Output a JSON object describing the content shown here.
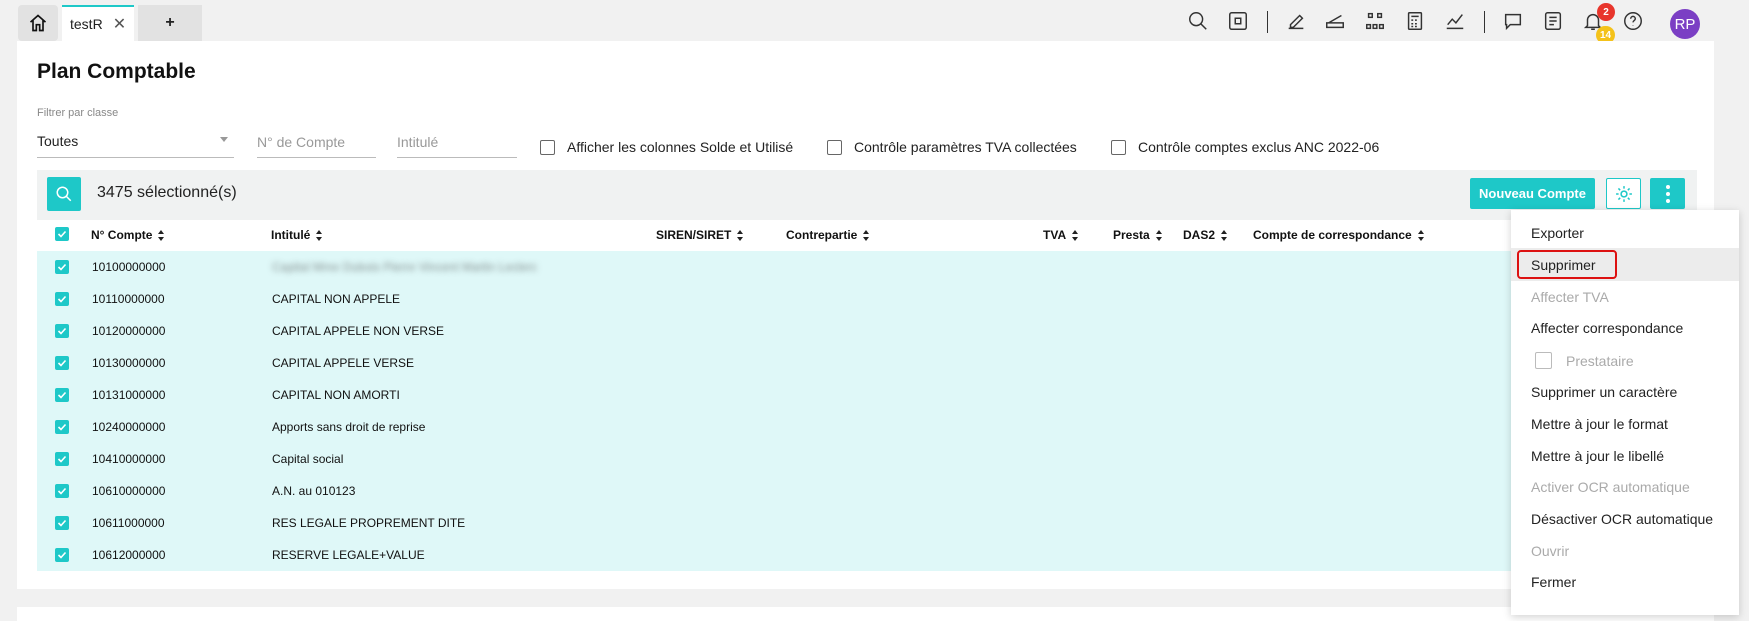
{
  "tabs": {
    "active_label": "testR",
    "add_label": "+"
  },
  "header": {
    "icons": [
      "search-icon",
      "command-icon",
      "edit-icon",
      "scanner-icon",
      "org-chart-icon",
      "calculator-icon",
      "chart-icon",
      "chat-icon",
      "checklist-icon",
      "bell-icon",
      "help-icon"
    ],
    "notif_red": "2",
    "notif_yellow": "14",
    "avatar": "RP"
  },
  "page": {
    "title": "Plan Comptable",
    "filter_label": "Filtrer par classe",
    "filter_value": "Toutes",
    "account_placeholder": "N° de Compte",
    "intitule_placeholder": "Intitulé",
    "checkboxes": [
      "Afficher les colonnes Solde et Utilisé",
      "Contrôle paramètres TVA collectées",
      "Contrôle comptes exclus ANC 2022-06"
    ]
  },
  "toolbar": {
    "selected_count": "3475 sélectionné(s)",
    "new_account": "Nouveau Compte"
  },
  "table": {
    "columns": [
      "N° Compte",
      "Intitulé",
      "SIREN/SIRET",
      "Contrepartie",
      "TVA",
      "Presta",
      "DAS2",
      "Compte de correspondance"
    ],
    "rows": [
      {
        "num": "10100000000",
        "label": "Capital Mme Dubois Pierre Vincent Martin Leclerc"
      },
      {
        "num": "10110000000",
        "label": "CAPITAL NON APPELE"
      },
      {
        "num": "10120000000",
        "label": "CAPITAL APPELE NON VERSE"
      },
      {
        "num": "10130000000",
        "label": "CAPITAL APPELE VERSE"
      },
      {
        "num": "10131000000",
        "label": "CAPITAL NON AMORTI"
      },
      {
        "num": "10240000000",
        "label": "Apports sans droit de reprise"
      },
      {
        "num": "10410000000",
        "label": "Capital social"
      },
      {
        "num": "10610000000",
        "label": "A.N. au 010123"
      },
      {
        "num": "10611000000",
        "label": "RES LEGALE PROPREMENT DITE"
      },
      {
        "num": "10612000000",
        "label": "RESERVE LEGALE+VALUE"
      }
    ]
  },
  "menu": {
    "items": [
      {
        "label": "Exporter",
        "disabled": false
      },
      {
        "label": "Supprimer",
        "disabled": false
      },
      {
        "label": "Affecter TVA",
        "disabled": true
      },
      {
        "label": "Affecter correspondance",
        "disabled": false
      },
      {
        "label": "Prestataire",
        "disabled": true
      },
      {
        "label": "Supprimer un caractère",
        "disabled": false
      },
      {
        "label": "Mettre à jour le format",
        "disabled": false
      },
      {
        "label": "Mettre à jour le libellé",
        "disabled": false
      },
      {
        "label": "Activer OCR automatique",
        "disabled": true
      },
      {
        "label": "Désactiver OCR automatique",
        "disabled": false
      },
      {
        "label": "Ouvrir",
        "disabled": true
      },
      {
        "label": "Fermer",
        "disabled": false
      }
    ]
  },
  "colors": {
    "accent": "#1ec8c8",
    "row_bg": "#dff8f8",
    "avatar": "#7b3fc4",
    "highlight": "#d11111"
  }
}
